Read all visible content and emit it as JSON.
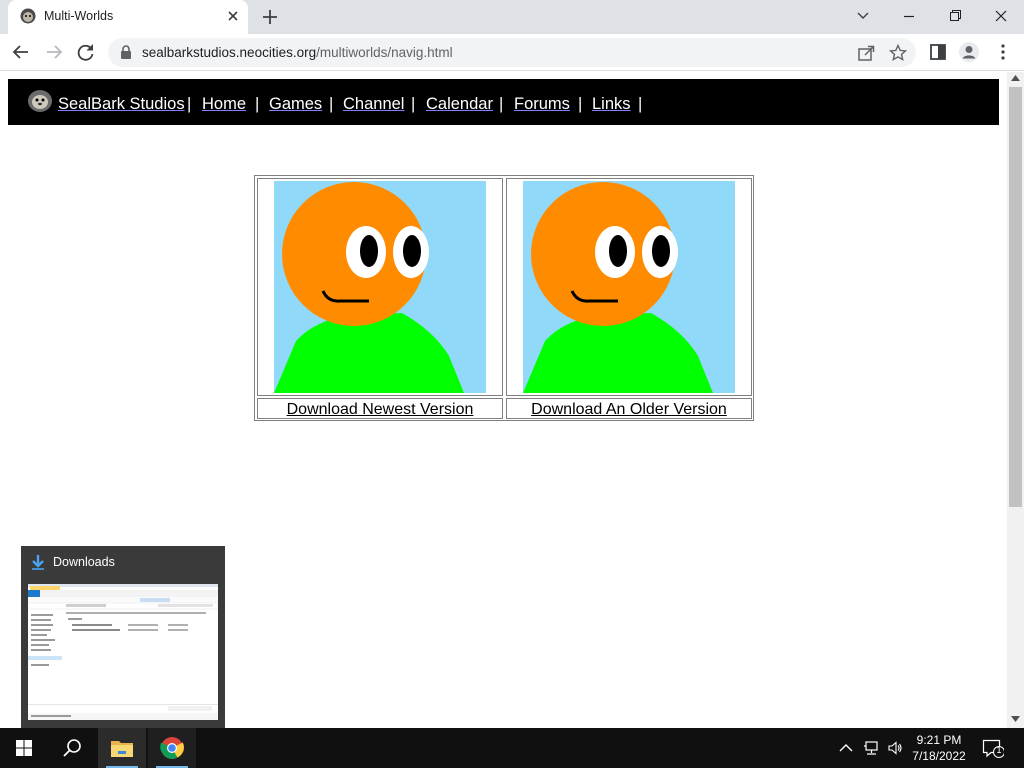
{
  "browser": {
    "tab_title": "Multi-Worlds",
    "url_host": "sealbarkstudios.neocities.org",
    "url_path": "/multiworlds/navig.html"
  },
  "site_nav": {
    "brand": "SealBark Studios",
    "separator": "|",
    "items": [
      {
        "label": "Home"
      },
      {
        "label": "Games"
      },
      {
        "label": "Channel"
      },
      {
        "label": "Calendar"
      },
      {
        "label": "Forums"
      },
      {
        "label": "Links"
      }
    ]
  },
  "downloads": {
    "newest_label": "Download Newest Version",
    "older_label": "Download An Older Version"
  },
  "thumbnail_popup": {
    "title": "Downloads"
  },
  "taskbar": {
    "time": "9:21 PM",
    "date": "7/18/2022",
    "notification_count": "1"
  },
  "colors": {
    "avatar_sky": "#91d9f8",
    "avatar_face": "#ff8c00",
    "avatar_body": "#00ff00",
    "nav_background": "#000000",
    "taskbar": "#101010"
  },
  "icons": [
    "favicon-seal-icon",
    "close-icon",
    "plus-icon",
    "chevron-down-icon",
    "minimize-icon",
    "maximize-icon",
    "back-icon",
    "forward-icon",
    "reload-icon",
    "lock-icon",
    "share-icon",
    "star-icon",
    "side-panel-icon",
    "profile-icon",
    "kebab-menu-icon",
    "windows-start-icon",
    "search-icon",
    "file-explorer-icon",
    "chrome-icon",
    "chevron-up-icon",
    "network-icon",
    "volume-icon",
    "notification-icon",
    "download-icon"
  ]
}
